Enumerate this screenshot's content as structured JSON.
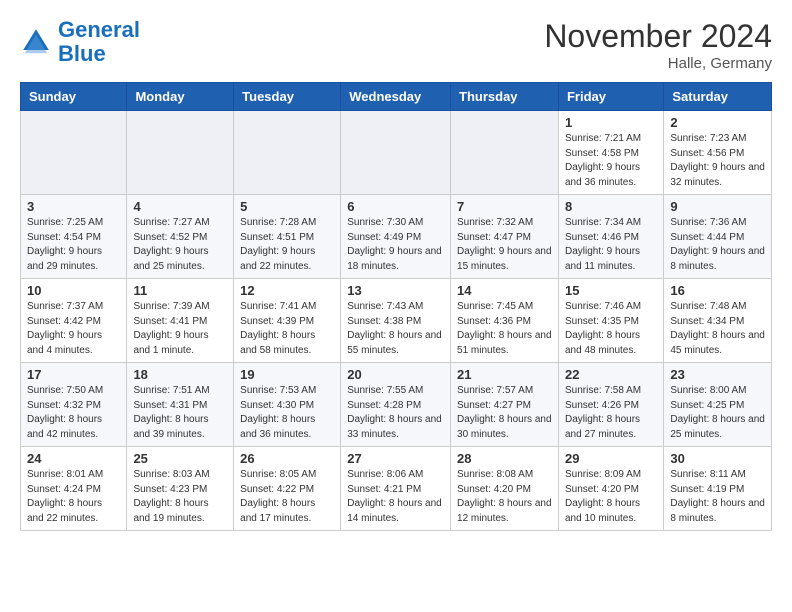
{
  "logo": {
    "line1": "General",
    "line2": "Blue"
  },
  "title": "November 2024",
  "location": "Halle, Germany",
  "days_header": [
    "Sunday",
    "Monday",
    "Tuesday",
    "Wednesday",
    "Thursday",
    "Friday",
    "Saturday"
  ],
  "weeks": [
    [
      {
        "day": "",
        "info": ""
      },
      {
        "day": "",
        "info": ""
      },
      {
        "day": "",
        "info": ""
      },
      {
        "day": "",
        "info": ""
      },
      {
        "day": "",
        "info": ""
      },
      {
        "day": "1",
        "info": "Sunrise: 7:21 AM\nSunset: 4:58 PM\nDaylight: 9 hours and 36 minutes."
      },
      {
        "day": "2",
        "info": "Sunrise: 7:23 AM\nSunset: 4:56 PM\nDaylight: 9 hours and 32 minutes."
      }
    ],
    [
      {
        "day": "3",
        "info": "Sunrise: 7:25 AM\nSunset: 4:54 PM\nDaylight: 9 hours and 29 minutes."
      },
      {
        "day": "4",
        "info": "Sunrise: 7:27 AM\nSunset: 4:52 PM\nDaylight: 9 hours and 25 minutes."
      },
      {
        "day": "5",
        "info": "Sunrise: 7:28 AM\nSunset: 4:51 PM\nDaylight: 9 hours and 22 minutes."
      },
      {
        "day": "6",
        "info": "Sunrise: 7:30 AM\nSunset: 4:49 PM\nDaylight: 9 hours and 18 minutes."
      },
      {
        "day": "7",
        "info": "Sunrise: 7:32 AM\nSunset: 4:47 PM\nDaylight: 9 hours and 15 minutes."
      },
      {
        "day": "8",
        "info": "Sunrise: 7:34 AM\nSunset: 4:46 PM\nDaylight: 9 hours and 11 minutes."
      },
      {
        "day": "9",
        "info": "Sunrise: 7:36 AM\nSunset: 4:44 PM\nDaylight: 9 hours and 8 minutes."
      }
    ],
    [
      {
        "day": "10",
        "info": "Sunrise: 7:37 AM\nSunset: 4:42 PM\nDaylight: 9 hours and 4 minutes."
      },
      {
        "day": "11",
        "info": "Sunrise: 7:39 AM\nSunset: 4:41 PM\nDaylight: 9 hours and 1 minute."
      },
      {
        "day": "12",
        "info": "Sunrise: 7:41 AM\nSunset: 4:39 PM\nDaylight: 8 hours and 58 minutes."
      },
      {
        "day": "13",
        "info": "Sunrise: 7:43 AM\nSunset: 4:38 PM\nDaylight: 8 hours and 55 minutes."
      },
      {
        "day": "14",
        "info": "Sunrise: 7:45 AM\nSunset: 4:36 PM\nDaylight: 8 hours and 51 minutes."
      },
      {
        "day": "15",
        "info": "Sunrise: 7:46 AM\nSunset: 4:35 PM\nDaylight: 8 hours and 48 minutes."
      },
      {
        "day": "16",
        "info": "Sunrise: 7:48 AM\nSunset: 4:34 PM\nDaylight: 8 hours and 45 minutes."
      }
    ],
    [
      {
        "day": "17",
        "info": "Sunrise: 7:50 AM\nSunset: 4:32 PM\nDaylight: 8 hours and 42 minutes."
      },
      {
        "day": "18",
        "info": "Sunrise: 7:51 AM\nSunset: 4:31 PM\nDaylight: 8 hours and 39 minutes."
      },
      {
        "day": "19",
        "info": "Sunrise: 7:53 AM\nSunset: 4:30 PM\nDaylight: 8 hours and 36 minutes."
      },
      {
        "day": "20",
        "info": "Sunrise: 7:55 AM\nSunset: 4:28 PM\nDaylight: 8 hours and 33 minutes."
      },
      {
        "day": "21",
        "info": "Sunrise: 7:57 AM\nSunset: 4:27 PM\nDaylight: 8 hours and 30 minutes."
      },
      {
        "day": "22",
        "info": "Sunrise: 7:58 AM\nSunset: 4:26 PM\nDaylight: 8 hours and 27 minutes."
      },
      {
        "day": "23",
        "info": "Sunrise: 8:00 AM\nSunset: 4:25 PM\nDaylight: 8 hours and 25 minutes."
      }
    ],
    [
      {
        "day": "24",
        "info": "Sunrise: 8:01 AM\nSunset: 4:24 PM\nDaylight: 8 hours and 22 minutes."
      },
      {
        "day": "25",
        "info": "Sunrise: 8:03 AM\nSunset: 4:23 PM\nDaylight: 8 hours and 19 minutes."
      },
      {
        "day": "26",
        "info": "Sunrise: 8:05 AM\nSunset: 4:22 PM\nDaylight: 8 hours and 17 minutes."
      },
      {
        "day": "27",
        "info": "Sunrise: 8:06 AM\nSunset: 4:21 PM\nDaylight: 8 hours and 14 minutes."
      },
      {
        "day": "28",
        "info": "Sunrise: 8:08 AM\nSunset: 4:20 PM\nDaylight: 8 hours and 12 minutes."
      },
      {
        "day": "29",
        "info": "Sunrise: 8:09 AM\nSunset: 4:20 PM\nDaylight: 8 hours and 10 minutes."
      },
      {
        "day": "30",
        "info": "Sunrise: 8:11 AM\nSunset: 4:19 PM\nDaylight: 8 hours and 8 minutes."
      }
    ]
  ]
}
